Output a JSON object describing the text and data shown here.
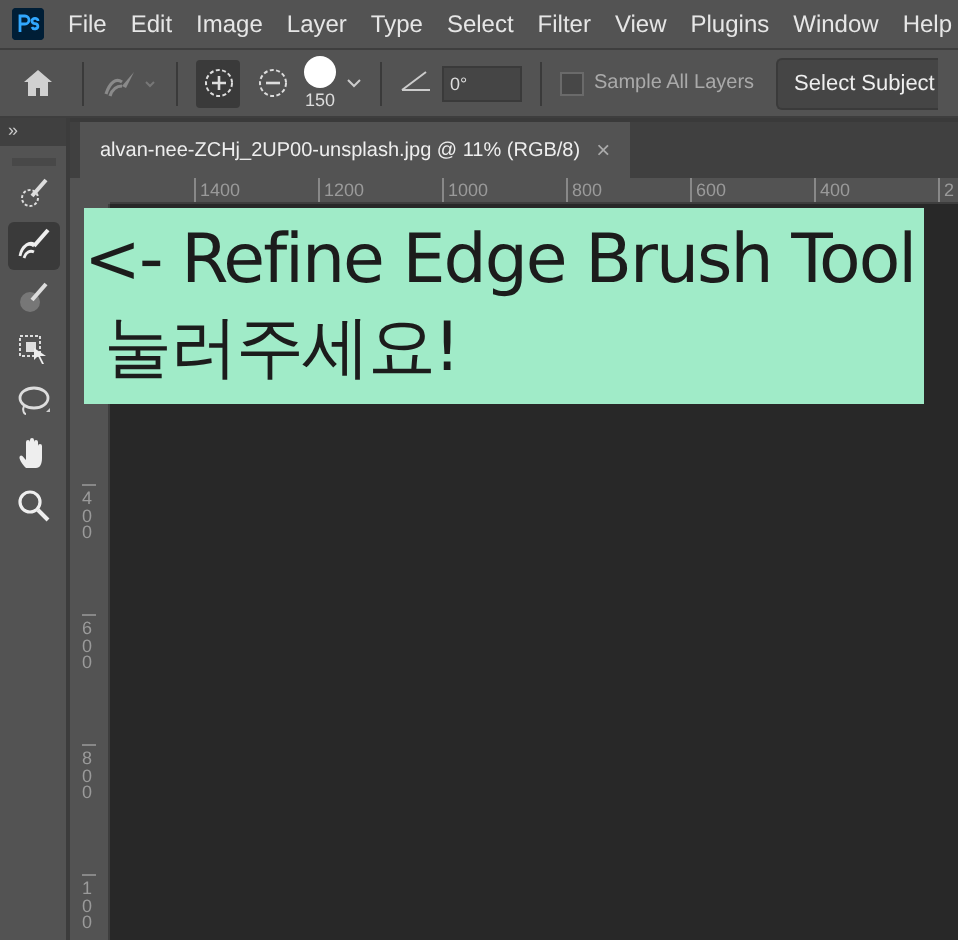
{
  "menu_bar": {
    "items": [
      "File",
      "Edit",
      "Image",
      "Layer",
      "Type",
      "Select",
      "Filter",
      "View",
      "Plugins",
      "Window",
      "Help"
    ]
  },
  "options_bar": {
    "modes": [
      {
        "kind": "add",
        "selected": true
      },
      {
        "kind": "subtract",
        "selected": false
      }
    ],
    "brush_size": "150",
    "angle": "0°",
    "sample_all_layers": {
      "label": "Sample All Layers",
      "checked": false,
      "disabled": true
    },
    "select_subject": "Select Subject"
  },
  "toolbar": {
    "collapse": "»",
    "tools": [
      {
        "kind": "quick",
        "selected": false
      },
      {
        "kind": "refine",
        "selected": true
      },
      {
        "kind": "sample",
        "selected": false
      },
      {
        "kind": "object",
        "selected": false
      },
      {
        "kind": "lasso",
        "selected": false
      },
      {
        "kind": "hand",
        "selected": false
      },
      {
        "kind": "zoom",
        "selected": false
      }
    ]
  },
  "document": {
    "tab": {
      "title": "alvan-nee-ZCHj_2UP00-unsplash.jpg @ 11% (RGB/8)",
      "close": "×"
    },
    "horizontal_ruler": [
      "1400",
      "1200",
      "1000",
      "800",
      "600",
      "400",
      "2"
    ],
    "vertical_ruler": [
      "400",
      "600",
      "800",
      "100"
    ],
    "annotation": {
      "lines": [
        "<- Refine Edge Brush Tool",
        " 눌러주세요!"
      ]
    }
  }
}
